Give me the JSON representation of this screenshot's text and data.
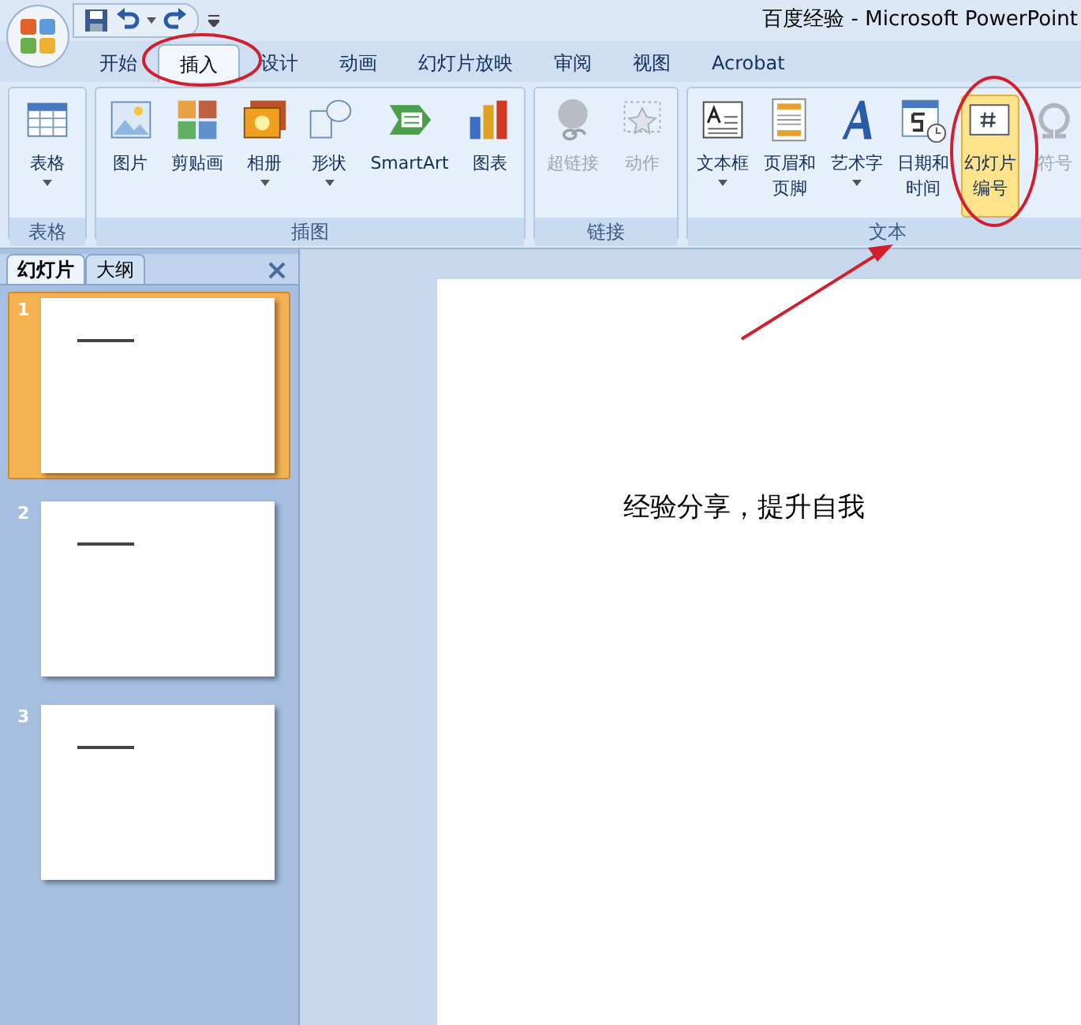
{
  "window": {
    "title": "百度经验 - Microsoft PowerPoint"
  },
  "tabs": [
    {
      "label": "开始",
      "selected": false
    },
    {
      "label": "插入",
      "selected": true
    },
    {
      "label": "设计",
      "selected": false
    },
    {
      "label": "动画",
      "selected": false
    },
    {
      "label": "幻灯片放映",
      "selected": false
    },
    {
      "label": "审阅",
      "selected": false
    },
    {
      "label": "视图",
      "selected": false
    },
    {
      "label": "Acrobat",
      "selected": false
    }
  ],
  "ribbon": {
    "groups": [
      {
        "label": "表格",
        "buttons": [
          {
            "lines": [
              "表格"
            ],
            "dropdown": true,
            "disabled": false,
            "highlighted": false
          }
        ]
      },
      {
        "label": "插图",
        "buttons": [
          {
            "lines": [
              "图片"
            ],
            "dropdown": false,
            "disabled": false,
            "highlighted": false
          },
          {
            "lines": [
              "剪贴画"
            ],
            "dropdown": false,
            "disabled": false,
            "highlighted": false
          },
          {
            "lines": [
              "相册"
            ],
            "dropdown": true,
            "disabled": false,
            "highlighted": false
          },
          {
            "lines": [
              "形状"
            ],
            "dropdown": true,
            "disabled": false,
            "highlighted": false
          },
          {
            "lines": [
              "SmartArt"
            ],
            "dropdown": false,
            "disabled": false,
            "highlighted": false
          },
          {
            "lines": [
              "图表"
            ],
            "dropdown": false,
            "disabled": false,
            "highlighted": false
          }
        ]
      },
      {
        "label": "链接",
        "buttons": [
          {
            "lines": [
              "超链接"
            ],
            "dropdown": false,
            "disabled": true,
            "highlighted": false
          },
          {
            "lines": [
              "动作"
            ],
            "dropdown": false,
            "disabled": true,
            "highlighted": false
          }
        ]
      },
      {
        "label": "文本",
        "buttons": [
          {
            "lines": [
              "文本框"
            ],
            "dropdown": true,
            "disabled": false,
            "highlighted": false
          },
          {
            "lines": [
              "页眉和",
              "页脚"
            ],
            "dropdown": false,
            "disabled": false,
            "highlighted": false
          },
          {
            "lines": [
              "艺术字"
            ],
            "dropdown": true,
            "disabled": false,
            "highlighted": false
          },
          {
            "lines": [
              "日期和",
              "时间"
            ],
            "dropdown": false,
            "disabled": false,
            "highlighted": false
          },
          {
            "lines": [
              "幻灯片",
              "编号"
            ],
            "dropdown": false,
            "disabled": false,
            "highlighted": true
          },
          {
            "lines": [
              "符号"
            ],
            "dropdown": false,
            "disabled": true,
            "highlighted": false
          }
        ]
      }
    ]
  },
  "panel": {
    "tabs": [
      {
        "label": "幻灯片",
        "selected": true
      },
      {
        "label": "大纲",
        "selected": false
      }
    ],
    "slides": [
      {
        "number": "1",
        "selected": true
      },
      {
        "number": "2",
        "selected": false
      },
      {
        "number": "3",
        "selected": false
      }
    ]
  },
  "slide": {
    "text": "经验分享，提升自我"
  }
}
